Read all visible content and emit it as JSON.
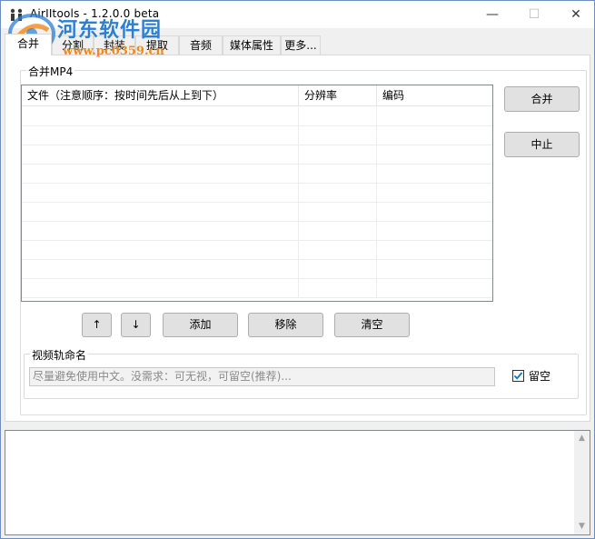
{
  "window": {
    "title": "AirIItools  -  1.2.0.0 beta",
    "minimize_glyph": "—",
    "maximize_glyph": "☐",
    "close_glyph": "✕"
  },
  "watermark": {
    "title": "河东软件园",
    "url": "www.pc0359.cn"
  },
  "tabs": [
    {
      "label": "合并",
      "active": true
    },
    {
      "label": "分割"
    },
    {
      "label": "封装"
    },
    {
      "label": "提取"
    },
    {
      "label": "音频"
    },
    {
      "label": "媒体属性"
    },
    {
      "label": "更多..."
    }
  ],
  "merge_group": {
    "title": "合并MP4",
    "columns": [
      "文件（注意顺序：按时间先后从上到下）",
      "分辨率",
      "编码"
    ],
    "buttons": {
      "merge": "合并",
      "stop": "中止",
      "up": "↑",
      "down": "↓",
      "add": "添加",
      "remove": "移除",
      "clear": "清空"
    }
  },
  "track_group": {
    "title": "视频轨命名",
    "placeholder": "尽量避免使用中文。没需求：可无视，可留空(推荐)...",
    "leave_empty_label": "留空",
    "leave_empty_checked": true
  },
  "log": {
    "scroll_up": "▲",
    "scroll_down": "▼"
  },
  "colors": {
    "accent": "#0078d7",
    "watermark_blue": "#2a7fd6",
    "watermark_orange": "#f08a1a"
  }
}
